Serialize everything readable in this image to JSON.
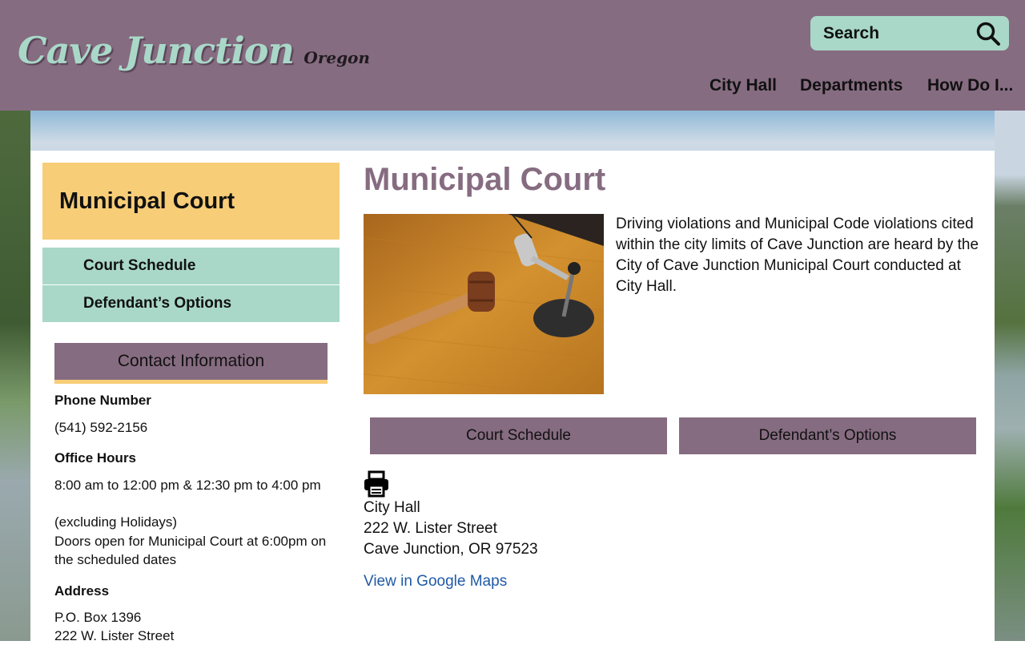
{
  "header": {
    "logo_main": "Cave Junction",
    "logo_sub": "Oregon",
    "search_placeholder": "Search",
    "nav": [
      "City Hall",
      "Departments",
      "How Do I..."
    ]
  },
  "sidebar": {
    "title": "Municipal Court",
    "links": [
      "Court Schedule",
      "Defendant’s Options"
    ],
    "contact": {
      "heading": "Contact Information",
      "phone_label": "Phone Number",
      "phone": "(541) 592-2156",
      "hours_label": "Office Hours",
      "hours_lines": [
        "8:00 am to 12:00 pm & 12:30 pm to 4:00 pm",
        "(excluding Holidays)",
        "Doors open for Municipal Court at 6:00pm on the scheduled dates"
      ],
      "address_label": "Address",
      "address_lines": [
        "P.O. Box 1396",
        "222 W. Lister Street"
      ]
    }
  },
  "main": {
    "title": "Municipal Court",
    "intro": "Driving violations and Municipal Code violations cited within the city limits of Cave Junction are heard by the City of Cave Junction Municipal Court conducted at City Hall.",
    "buttons": [
      "Court Schedule",
      "Defendant’s Options"
    ],
    "address_lines": [
      "City Hall",
      "222 W. Lister Street",
      "Cave Junction, OR 97523"
    ],
    "maps_link": "View in Google Maps"
  },
  "colors": {
    "header": "#866c81",
    "accent_green": "#a9d8c8",
    "accent_yellow": "#f7cd78",
    "link": "#1f5aa6"
  },
  "icons": [
    "search-icon",
    "print-icon"
  ]
}
